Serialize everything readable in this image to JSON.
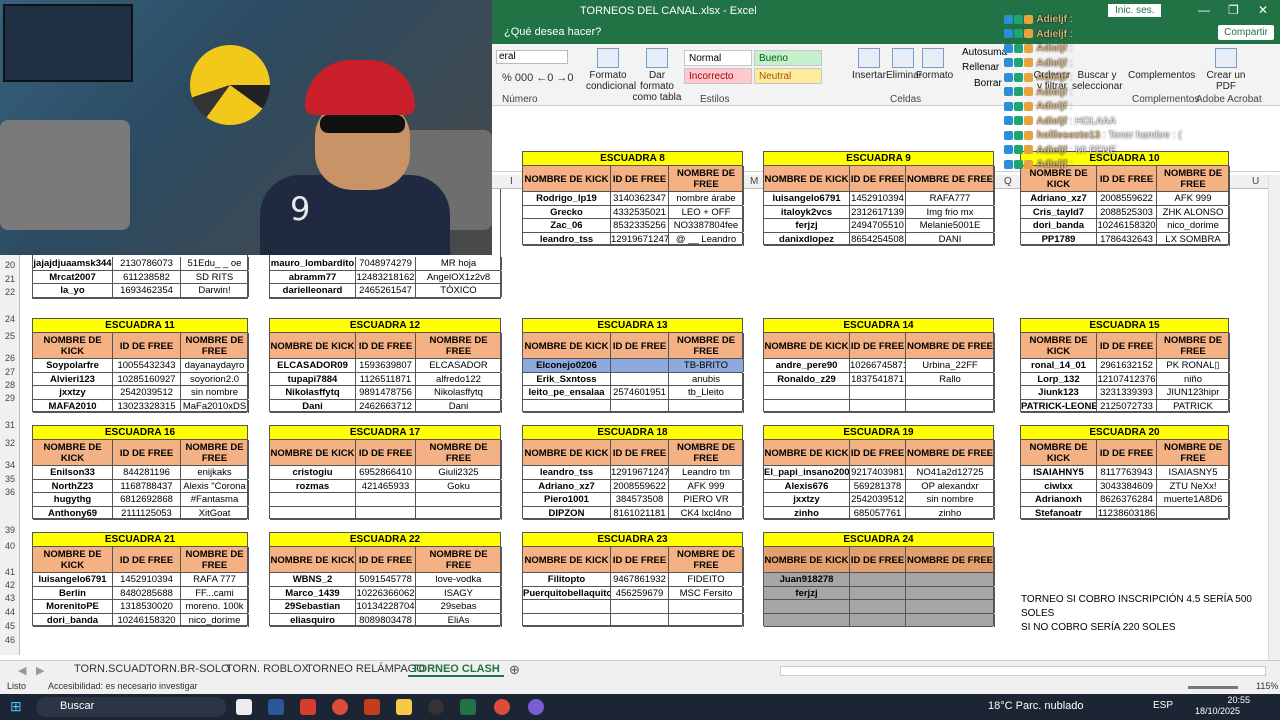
{
  "app": {
    "title": "TORNEOS DEL CANAL.xlsx  -  Excel",
    "signin": "Inic. ses.",
    "tellme": "¿Qué desea hacer?",
    "share": "Compartir",
    "minimize": "—",
    "maximize": "❐",
    "close": "✕"
  },
  "ribbon": {
    "number_format": "eral",
    "number_group": "Número",
    "styles_group": "Estilos",
    "cells_group": "Celdas",
    "addins_group": "Complementos",
    "acrobat_group": "Adobe Acrobat",
    "format_cond": "Formato condicional",
    "format_table": "Dar formato como tabla",
    "styles": {
      "normal": "Normal",
      "bueno": "Bueno",
      "incorrecto": "Incorrecto",
      "neutral": "Neutral"
    },
    "insertar": "Insertar",
    "eliminar": "Eliminar",
    "formato": "Formato",
    "autosuma": "Autosuma",
    "rellenar": "Rellenar",
    "borrar": "Borrar",
    "ordenar": "Ordenar y filtrar",
    "buscar": "Buscar y seleccionar",
    "complementos": "Complementos",
    "crear_pdf": "Crear un PDF"
  },
  "columns": [
    "I",
    "J",
    "K",
    "L",
    "M",
    "N",
    "O",
    "P",
    "Q",
    "R",
    "S",
    "T",
    "U"
  ],
  "rows": [
    "20",
    "21",
    "22",
    "",
    "24",
    "25",
    "26",
    "27",
    "28",
    "29",
    "",
    "31",
    "32",
    "",
    "34",
    "35",
    "36",
    "",
    "38",
    "39",
    "40",
    "",
    "41",
    "42",
    "43",
    "44",
    "45",
    "46"
  ],
  "chat": [
    {
      "user": "Adieljf",
      "msg": ":"
    },
    {
      "user": "Adieljf",
      "msg": ":"
    },
    {
      "user": "Adieljf",
      "msg": ":"
    },
    {
      "user": "Adieljf",
      "msg": ":"
    },
    {
      "user": "Adieljf",
      "msg": ":"
    },
    {
      "user": "Adieljf",
      "msg": ":"
    },
    {
      "user": "Adieljf",
      "msg": ":"
    },
    {
      "user": "Adieljf",
      "msg": ": HOLAAA"
    },
    {
      "user": "holllesexto13",
      "msg": ": Tener hambre : ("
    },
    {
      "user": "Adieljf",
      "msg": ": MI PENE"
    },
    {
      "user": "Adieljf",
      "msg": ":"
    }
  ],
  "headers": {
    "kick": "NOMBRE DE KICK",
    "id": "ID DE FREE",
    "free": "NOMBRE DE FREE"
  },
  "squads": [
    {
      "name": "",
      "rows": [
        [
          "jajajdjuaamsk344",
          "2130786073",
          "51Edu_ _ oe"
        ],
        [
          "Mrcat2007",
          "611238582",
          "SD RITS"
        ],
        [
          "la_yo",
          "1693462354",
          "Darwin!"
        ]
      ]
    },
    {
      "name": "",
      "rows": [
        [
          "mauro_lombardito",
          "7048974279",
          "MR hoja"
        ],
        [
          "abramm77",
          "12483218162",
          "AngelOX1z2v8"
        ],
        [
          "darielleonard",
          "2465261547",
          "TÓXICO"
        ]
      ]
    },
    {
      "name": "ESCUADRA 8",
      "rows": [
        [
          "Rodrigo_lp19",
          "3140362347",
          "nombre árabe"
        ],
        [
          "Grecko",
          "4332535021",
          "LEO + OFF"
        ],
        [
          "Zac_06",
          "8532335256",
          "NO3387804fee"
        ],
        [
          "leandro_tss",
          "12919671247",
          "@ __ Leandro"
        ]
      ]
    },
    {
      "name": "ESCUADRA 9",
      "rows": [
        [
          "luisangelo6791",
          "1452910394",
          "RAFA777"
        ],
        [
          "italoyk2vcs",
          "2312617139",
          "Img frio mx"
        ],
        [
          "ferjzj",
          "2494705510",
          "Melanie5001E"
        ],
        [
          "danixdlopez",
          "8654254508",
          "DANI"
        ]
      ]
    },
    {
      "name": "ESCUADRA 10",
      "rows": [
        [
          "Adriano_xz7",
          "2008559622",
          "AFK 999"
        ],
        [
          "Cris_tayld7",
          "2088525303",
          "ZHK ALONSO"
        ],
        [
          "dori_banda",
          "10246158320",
          "nico_dorime"
        ],
        [
          "PP1789",
          "1786432643",
          "LX SOMBRA"
        ]
      ]
    },
    {
      "name": "ESCUADRA 11",
      "rows": [
        [
          "Soypolarfre",
          "10055432343",
          "dayanaydayro"
        ],
        [
          "Alvieri123",
          "10285160927",
          "soyorion2.0"
        ],
        [
          "jxxtzy",
          "2542039512",
          "sin nombre"
        ],
        [
          "MAFA2010",
          "13023328315",
          "MaFa2010xDS"
        ]
      ]
    },
    {
      "name": "ESCUADRA 12",
      "rows": [
        [
          "ELCASADOR09",
          "1593639807",
          "ELCASADOR"
        ],
        [
          "tupapi7884",
          "1126511871",
          "alfredo122"
        ],
        [
          "Nikolasffytq",
          "9891478756",
          "Nikolasffytq"
        ],
        [
          "Dani",
          "2462663712",
          "Dani"
        ]
      ]
    },
    {
      "name": "ESCUADRA 13",
      "rows": [
        [
          "Elconejo0206",
          "",
          "TB-BRITO"
        ],
        [
          "Erik_Sxntoss",
          "",
          "anubis"
        ],
        [
          "leito_pe_ensalaa",
          "2574601951",
          "tb_Lleito"
        ],
        [
          "",
          "",
          ""
        ]
      ]
    },
    {
      "name": "ESCUADRA 14",
      "rows": [
        [
          "andre_pere90",
          "10266745871",
          "Urbina_22FF"
        ],
        [
          "Ronaldo_z29",
          "1837541871",
          "Rallo"
        ],
        [
          "",
          "",
          ""
        ],
        [
          "",
          "",
          ""
        ]
      ]
    },
    {
      "name": "ESCUADRA 15",
      "rows": [
        [
          "ronal_14_01",
          "2961632152",
          "PK RONAL▯"
        ],
        [
          "Lorp_132",
          "12107412376",
          "niño"
        ],
        [
          "Jiunk123",
          "3231339393",
          "JIUN123hipr"
        ],
        [
          "PATRICK-LEONEL",
          "2125072733",
          "PATRICK"
        ]
      ]
    },
    {
      "name": "ESCUADRA 16",
      "rows": [
        [
          "Enilson33",
          "844281196",
          "enijkaks"
        ],
        [
          "NorthZ23",
          "1168788437",
          "Alexis \"Corona"
        ],
        [
          "hugythg",
          "6812692868",
          "#Fantasma"
        ],
        [
          "Anthony69",
          "2111125053",
          "XitGoat"
        ]
      ]
    },
    {
      "name": "ESCUADRA 17",
      "rows": [
        [
          "cristogiu",
          "6952866410",
          "Giuli2325"
        ],
        [
          "rozmas",
          "421465933",
          "Goku"
        ],
        [
          "",
          "",
          ""
        ],
        [
          "",
          "",
          ""
        ]
      ]
    },
    {
      "name": "ESCUADRA 18",
      "rows": [
        [
          "leandro_tss",
          "12919671247",
          "Leandro tm"
        ],
        [
          "Adriano_xz7",
          "2008559622",
          "AFK 999"
        ],
        [
          "Piero1001",
          "384573508",
          "PIERO VR"
        ],
        [
          "DIPZON",
          "8161021181",
          "CK4 lxcl4no"
        ]
      ]
    },
    {
      "name": "ESCUADRA 19",
      "rows": [
        [
          "El_papi_insano2009",
          "9217403981",
          "NO41a2d12725"
        ],
        [
          "Alexis676",
          "569281378",
          "OP alexandxr"
        ],
        [
          "jxxtzy",
          "2542039512",
          "sin nombre"
        ],
        [
          "zinho",
          "685057761",
          "zinho"
        ]
      ]
    },
    {
      "name": "ESCUADRA 20",
      "rows": [
        [
          "ISAIAHNY5",
          "8117763943",
          "ISAIASNY5"
        ],
        [
          "ciwlxx",
          "3043384609",
          "ZTU NeXx!"
        ],
        [
          "Adrianoxh",
          "8626376284",
          "muerte1A8D6"
        ],
        [
          "Stefanoatr",
          "11238603186",
          ""
        ]
      ]
    },
    {
      "name": "ESCUADRA 21",
      "rows": [
        [
          "luisangelo6791",
          "1452910394",
          "RAFA 777"
        ],
        [
          "Berlin",
          "8480285688",
          "FF...cami"
        ],
        [
          "MorenitoPE",
          "1318530020",
          "moreno. 100k"
        ],
        [
          "dori_banda",
          "10246158320",
          "nico_dorime"
        ]
      ]
    },
    {
      "name": "ESCUADRA 22",
      "rows": [
        [
          "WBNS_2",
          "5091545778",
          "love-vodka"
        ],
        [
          "Marco_1439",
          "10226366062",
          "ISAGY"
        ],
        [
          "29Sebastian",
          "10134228704",
          "29sebas"
        ],
        [
          "eliasquiro",
          "8089803478",
          "EliAs"
        ]
      ]
    },
    {
      "name": "ESCUADRA 23",
      "rows": [
        [
          "Filitopto",
          "9467861932",
          "FIDEITO"
        ],
        [
          "Puerquitobellaquito",
          "456259679",
          "MSC Fersito"
        ],
        [
          "",
          "",
          ""
        ],
        [
          "",
          "",
          ""
        ]
      ]
    },
    {
      "name": "ESCUADRA 24",
      "rows": [
        [
          "Juan918278",
          "",
          ""
        ],
        [
          "ferjzj",
          "",
          ""
        ],
        [
          "",
          "",
          ""
        ],
        [
          "",
          "",
          ""
        ]
      ]
    }
  ],
  "note": [
    "TORNEO SI COBRO INSCRIPCIÓN 4.5 SERÍA 500 SOLES",
    "SI NO COBRO SERÍA 220 SOLES"
  ],
  "tabs": [
    "TORN.SCUAD",
    "TORN.BR-SOLO",
    "TORN. ROBLOX",
    "TORNEO RELÁMPAGO",
    "TORNEO CLASH"
  ],
  "active_tab": "TORNEO CLASH",
  "status": {
    "ready": "Listo",
    "accessibility": "Accesibilidad: es necesario investigar",
    "zoom": "115%"
  },
  "taskbar": {
    "search": "Buscar",
    "weather": "18°C  Parc. nublado",
    "lang": "ESP",
    "time": "20:55",
    "date": "18/10/2025"
  }
}
